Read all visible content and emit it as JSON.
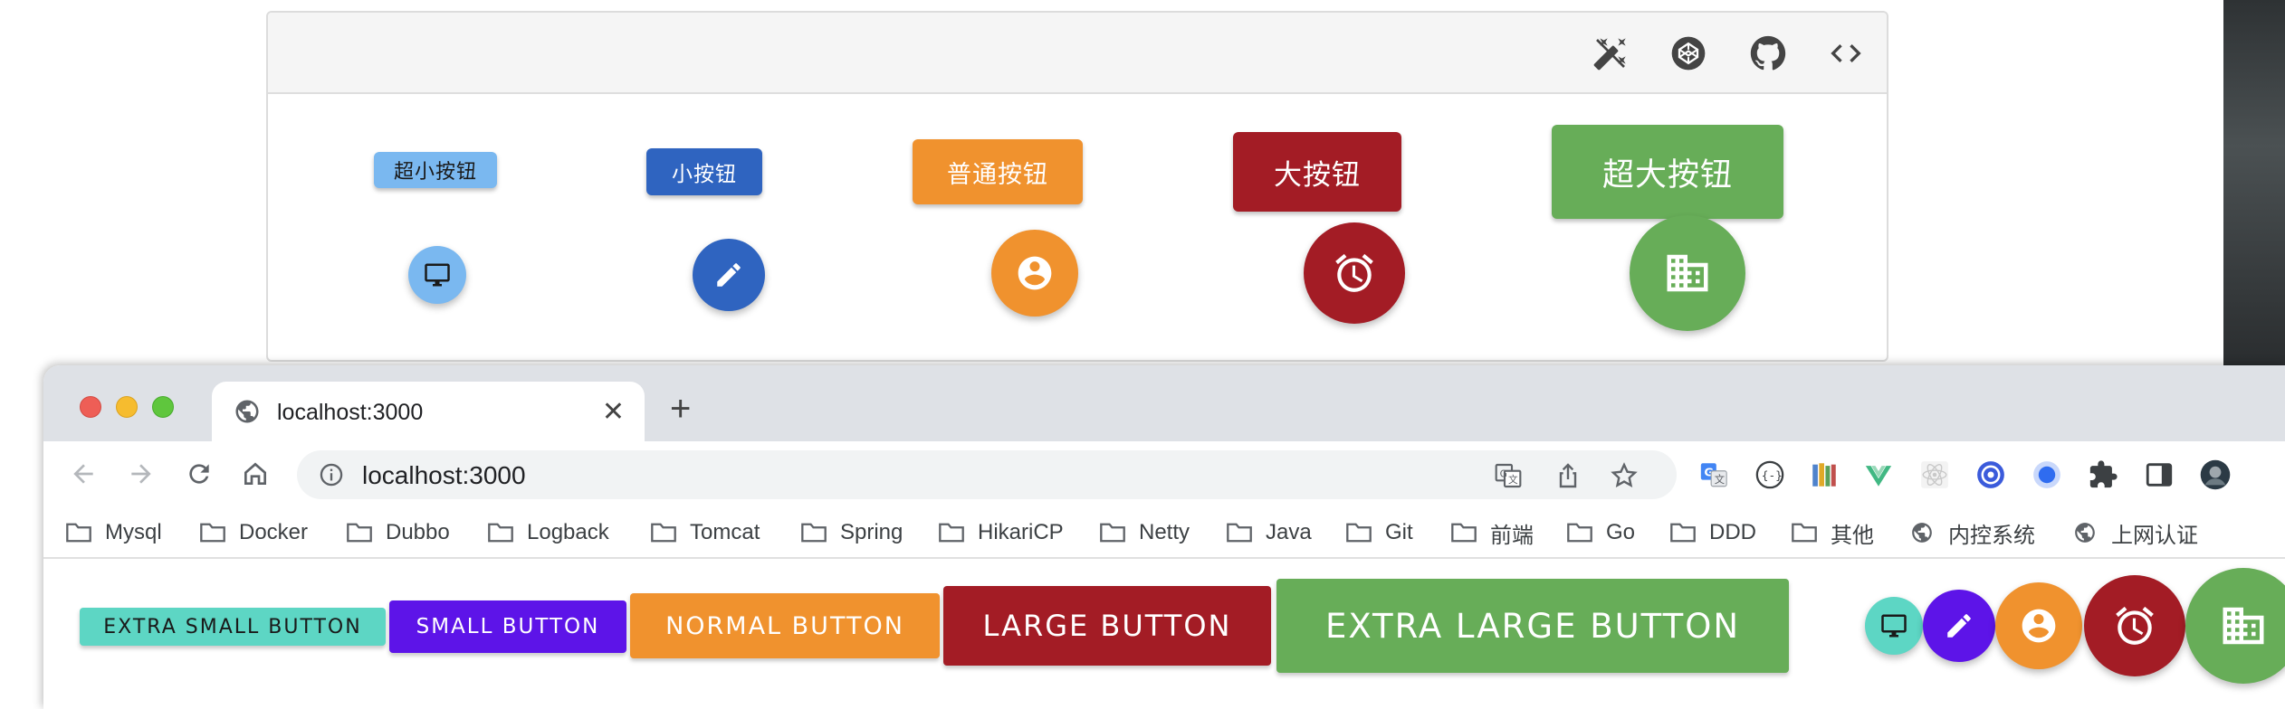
{
  "demo": {
    "buttons": [
      {
        "label": "超小按钮",
        "color": "#7ab8f0",
        "text": "#1a1a1a"
      },
      {
        "label": "小按钮",
        "color": "#2f64c0",
        "text": "#ffffff"
      },
      {
        "label": "普通按钮",
        "color": "#f0922e",
        "text": "#ffffff"
      },
      {
        "label": "大按钮",
        "color": "#a31c25",
        "text": "#ffffff"
      },
      {
        "label": "超大按钮",
        "color": "#67ad58",
        "text": "#ffffff"
      }
    ],
    "fabs": [
      {
        "icon": "desktop-icon",
        "color": "#7ab8f0"
      },
      {
        "icon": "pencil-icon",
        "color": "#2f64c0"
      },
      {
        "icon": "account-circle-icon",
        "color": "#f0922e"
      },
      {
        "icon": "alarm-clock-icon",
        "color": "#a31c25"
      },
      {
        "icon": "business-building-icon",
        "color": "#67ad58"
      }
    ],
    "toolbar_icons": [
      "theme-toggle-icon",
      "codepen-icon",
      "github-icon",
      "code-icon"
    ]
  },
  "browser": {
    "tab_title": "localhost:3000",
    "url": "localhost:3000",
    "bookmarks": [
      {
        "label": "Mysql",
        "icon": "folder-icon"
      },
      {
        "label": "Docker",
        "icon": "folder-icon"
      },
      {
        "label": "Dubbo",
        "icon": "folder-icon"
      },
      {
        "label": "Logback",
        "icon": "folder-icon"
      },
      {
        "label": "Tomcat",
        "icon": "folder-icon"
      },
      {
        "label": "Spring",
        "icon": "folder-icon"
      },
      {
        "label": "HikariCP",
        "icon": "folder-icon"
      },
      {
        "label": "Netty",
        "icon": "folder-icon"
      },
      {
        "label": "Java",
        "icon": "folder-icon"
      },
      {
        "label": "Git",
        "icon": "folder-icon"
      },
      {
        "label": "前端",
        "icon": "folder-icon"
      },
      {
        "label": "Go",
        "icon": "folder-icon"
      },
      {
        "label": "DDD",
        "icon": "folder-icon"
      },
      {
        "label": "其他",
        "icon": "folder-icon"
      },
      {
        "label": "内控系统",
        "icon": "globe-icon"
      },
      {
        "label": "上网认证",
        "icon": "globe-icon"
      }
    ]
  },
  "page": {
    "buttons": [
      {
        "label": "EXTRA SMALL BUTTON",
        "color": "#5dd6c4",
        "text": "#1a1a1a"
      },
      {
        "label": "SMALL BUTTON",
        "color": "#5d14e8",
        "text": "#ffffff"
      },
      {
        "label": "NORMAL BUTTON",
        "color": "#f0922e",
        "text": "#ffffff"
      },
      {
        "label": "LARGE BUTTON",
        "color": "#a31c25",
        "text": "#ffffff"
      },
      {
        "label": "EXTRA LARGE BUTTON",
        "color": "#67ad58",
        "text": "#ffffff"
      }
    ],
    "fabs": [
      {
        "icon": "desktop-icon",
        "color": "#5dd6c4"
      },
      {
        "icon": "pencil-icon",
        "color": "#5d14e8"
      },
      {
        "icon": "account-circle-icon",
        "color": "#f0922e"
      },
      {
        "icon": "alarm-clock-icon",
        "color": "#a31c25"
      },
      {
        "icon": "business-building-icon",
        "color": "#67ad58"
      }
    ]
  }
}
